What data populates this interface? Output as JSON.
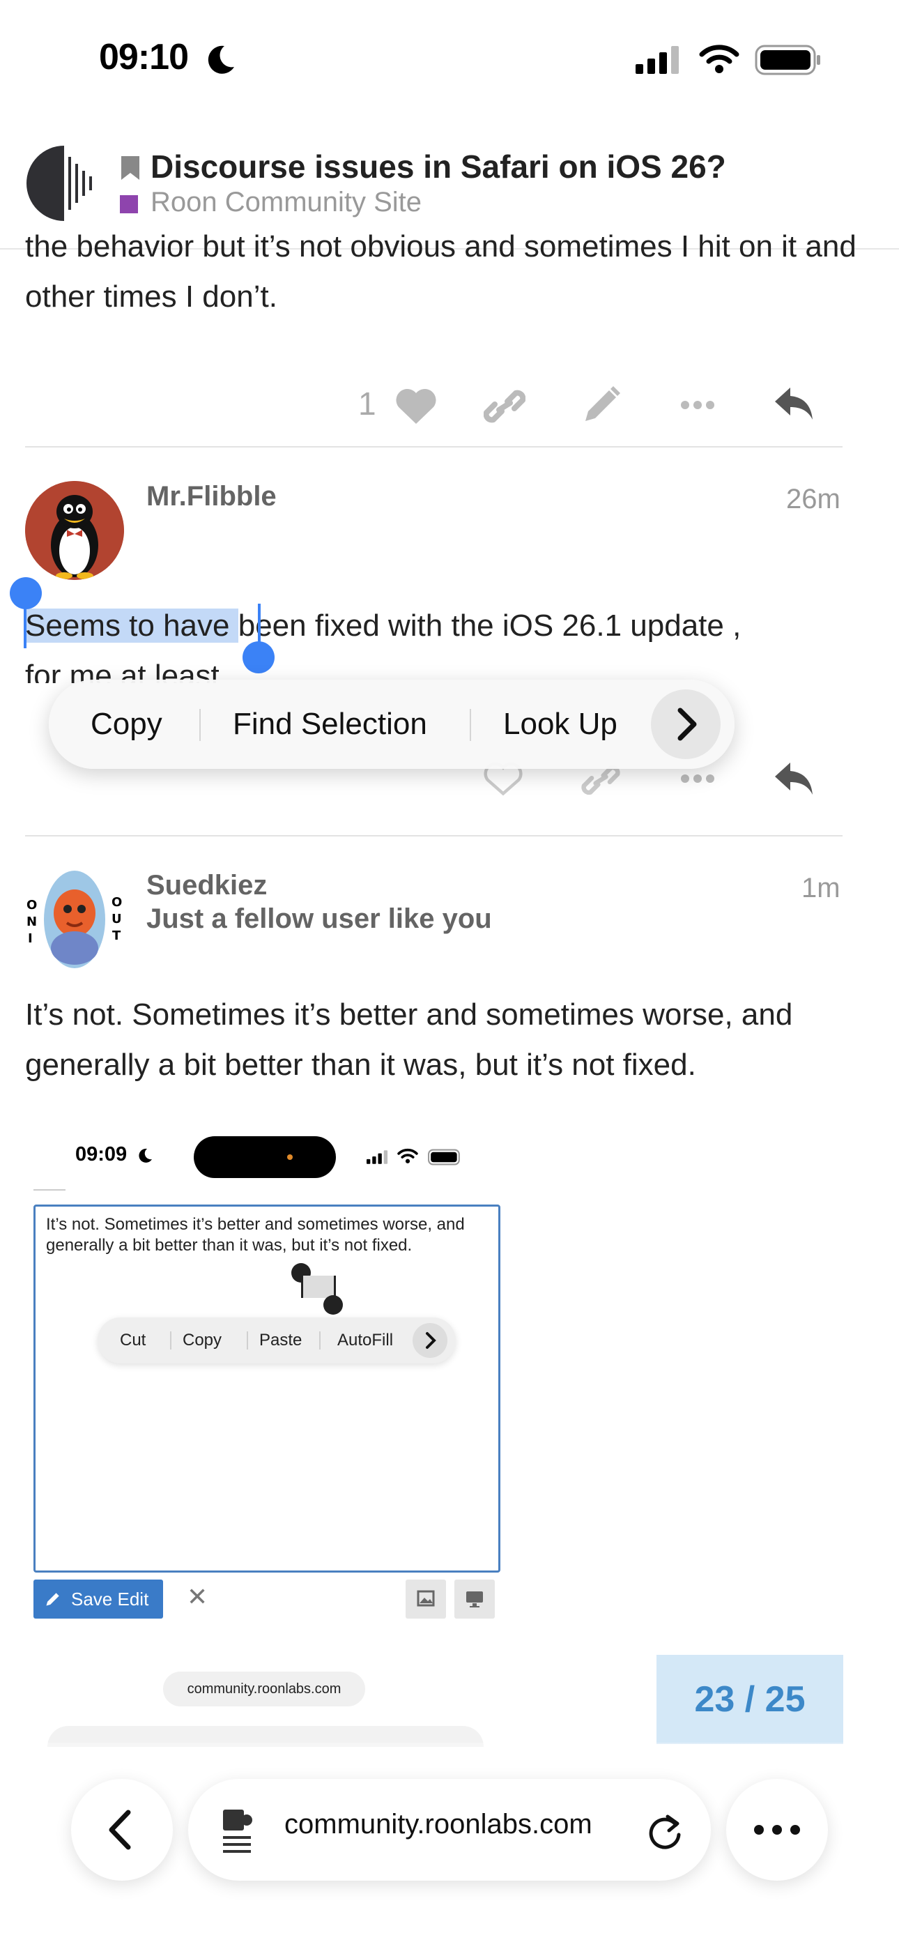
{
  "status_bar": {
    "time": "09:10",
    "icons": [
      "moon-icon",
      "cellular-signal-icon",
      "wifi-icon",
      "battery-icon"
    ]
  },
  "header": {
    "title": "Discourse issues in Safari on iOS 26?",
    "category": "Roon Community Site",
    "category_color": "#8e44ad",
    "logo": "roon-logo"
  },
  "previous_post": {
    "text_tail": "the behavior but it’s not obvious and sometimes I hit on it and other times I don’t.",
    "like_count": "1",
    "actions": [
      "heart-icon",
      "link-icon",
      "pencil-icon",
      "ellipsis-icon",
      "reply-icon"
    ]
  },
  "post_flibble": {
    "username": "Mr.Flibble",
    "time": "26m",
    "text_selected": "Seems to have ",
    "text_rest": "been fixed with the iOS 26.1 update ,",
    "text_line2": "for me at least"
  },
  "context_menu": {
    "items": [
      "Copy",
      "Find Selection",
      "Look Up"
    ],
    "more_icon": "chevron-right-icon"
  },
  "post_suedkiez": {
    "username": "Suedkiez",
    "user_title": "Just a fellow user like you",
    "time": "1m",
    "text": "It’s not. Sometimes it’s better and sometimes worse, and generally a bit better than it was, but it’s not fixed."
  },
  "embedded_screenshot": {
    "time": "09:09",
    "editor_text": "It’s not. Sometimes it’s better and sometimes worse, and generally a bit better than it was, but it’s not fixed.",
    "menu_items": [
      "Cut",
      "Copy",
      "Paste",
      "AutoFill"
    ],
    "save_label": "Save Edit",
    "close_label": "✕",
    "url": "community.roonlabs.com"
  },
  "progress": {
    "label": "23 / 25",
    "current": 23,
    "total": 25
  },
  "browser": {
    "url": "community.roonlabs.com",
    "accent": "#3c88c8"
  }
}
